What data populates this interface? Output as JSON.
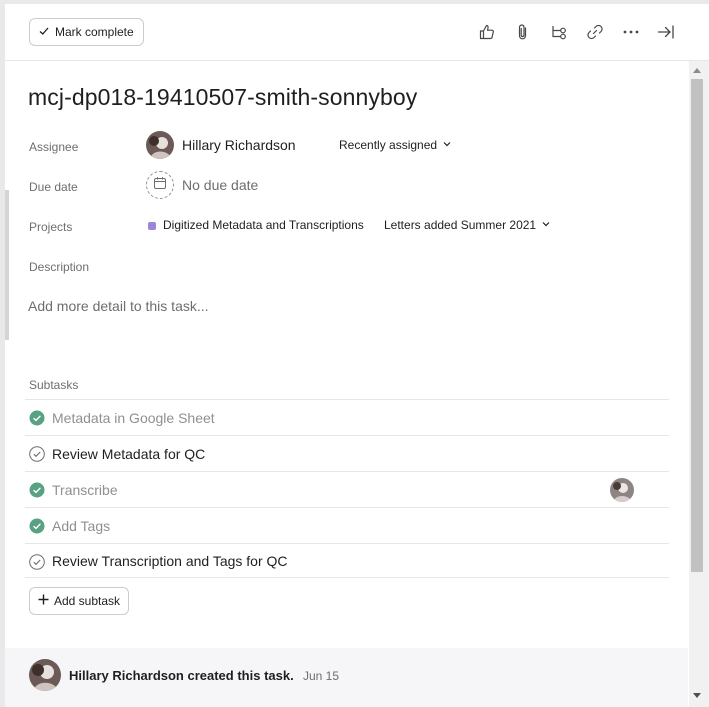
{
  "toolbar": {
    "mark_complete_label": "Mark complete",
    "icons": [
      "thumbs-up-icon",
      "paperclip-icon",
      "subtask-icon",
      "link-icon",
      "more-icon",
      "close-pane-icon"
    ]
  },
  "task": {
    "title": "mcj-dp018-19410507-smith-sonnyboy"
  },
  "fields": {
    "assignee_label": "Assignee",
    "assignee_name": "Hillary Richardson",
    "recently_assigned": "Recently assigned",
    "due_date_label": "Due date",
    "due_date_value": "No due date",
    "projects_label": "Projects",
    "project_name": "Digitized Metadata and Transcriptions",
    "project_color": "#9b86d8",
    "project_section": "Letters added Summer 2021",
    "description_label": "Description",
    "description_placeholder": "Add more detail to this task..."
  },
  "subtasks": {
    "header": "Subtasks",
    "items": [
      {
        "label": "Metadata in Google Sheet",
        "completed": true
      },
      {
        "label": "Review Metadata for QC",
        "completed": false
      },
      {
        "label": "Transcribe",
        "completed": true,
        "has_assignee": true
      },
      {
        "label": "Add Tags",
        "completed": true
      },
      {
        "label": "Review Transcription and Tags for QC",
        "completed": false
      }
    ],
    "add_label": "Add subtask"
  },
  "activity": {
    "text": "Hillary Richardson created this task.",
    "date": "Jun 15"
  },
  "colors": {
    "complete_green": "#58a182",
    "text_primary": "#1e1f21",
    "text_secondary": "#6d6e6f"
  }
}
